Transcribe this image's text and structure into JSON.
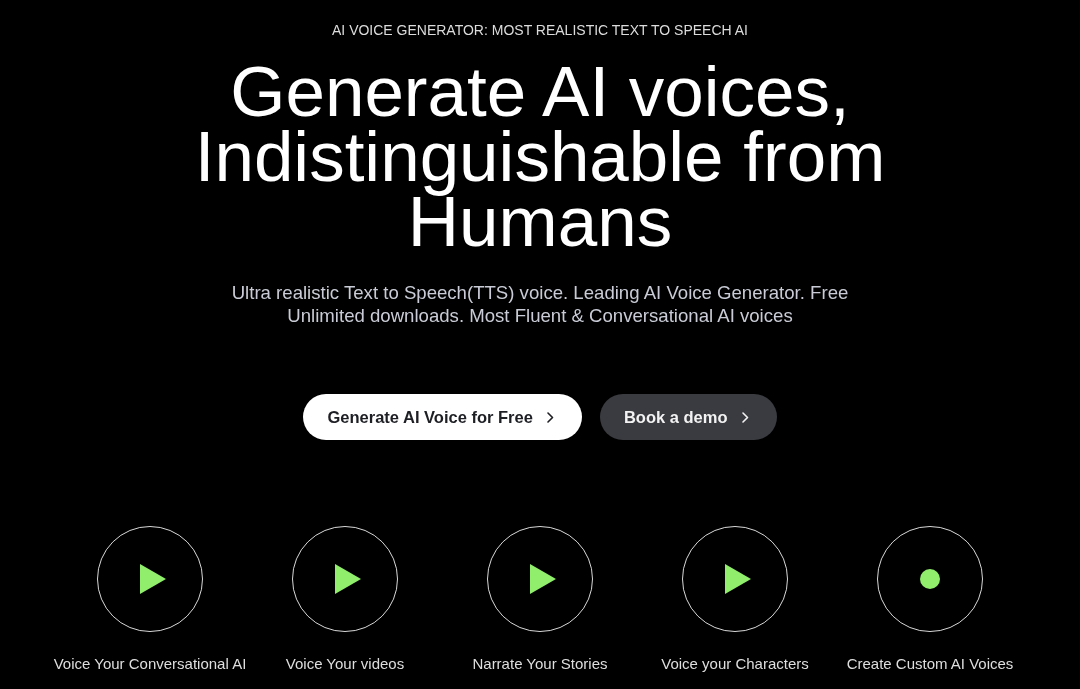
{
  "hero": {
    "eyebrow": "AI VOICE GENERATOR: MOST REALISTIC TEXT TO SPEECH AI",
    "heading": "Generate AI voices, Indistinguishable from Humans",
    "subtitle": "Ultra realistic Text to Speech(TTS) voice. Leading AI Voice Generator. Free Unlimited downloads. Most Fluent & Conversational AI voices",
    "buttons": [
      {
        "kind": "primary",
        "label": "Generate AI Voice for Free"
      },
      {
        "kind": "secondary",
        "label": "Book a demo"
      }
    ]
  },
  "use_cases": [
    {
      "kind": "play",
      "label": "Voice Your Conversational AI"
    },
    {
      "kind": "play",
      "label": "Voice Your videos"
    },
    {
      "kind": "play",
      "label": "Narrate Your Stories"
    },
    {
      "kind": "play",
      "label": "Voice your Characters"
    },
    {
      "kind": "record",
      "label": "Create Custom AI Voices"
    }
  ]
}
